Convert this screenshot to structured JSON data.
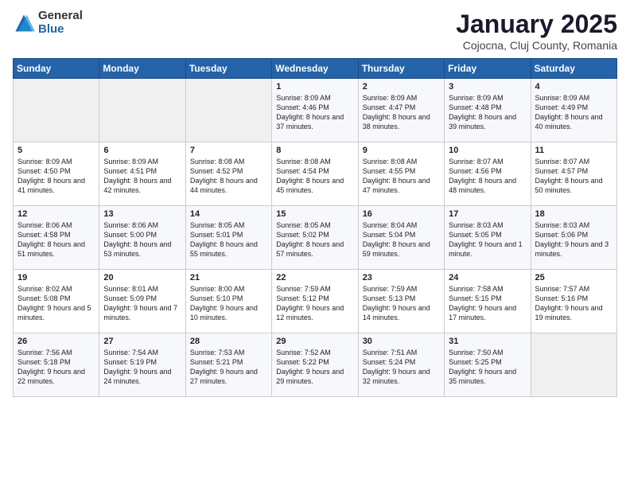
{
  "logo": {
    "general": "General",
    "blue": "Blue"
  },
  "header": {
    "month": "January 2025",
    "location": "Cojocna, Cluj County, Romania"
  },
  "days_of_week": [
    "Sunday",
    "Monday",
    "Tuesday",
    "Wednesday",
    "Thursday",
    "Friday",
    "Saturday"
  ],
  "weeks": [
    [
      {
        "day": "",
        "info": ""
      },
      {
        "day": "",
        "info": ""
      },
      {
        "day": "",
        "info": ""
      },
      {
        "day": "1",
        "info": "Sunrise: 8:09 AM\nSunset: 4:46 PM\nDaylight: 8 hours and 37 minutes."
      },
      {
        "day": "2",
        "info": "Sunrise: 8:09 AM\nSunset: 4:47 PM\nDaylight: 8 hours and 38 minutes."
      },
      {
        "day": "3",
        "info": "Sunrise: 8:09 AM\nSunset: 4:48 PM\nDaylight: 8 hours and 39 minutes."
      },
      {
        "day": "4",
        "info": "Sunrise: 8:09 AM\nSunset: 4:49 PM\nDaylight: 8 hours and 40 minutes."
      }
    ],
    [
      {
        "day": "5",
        "info": "Sunrise: 8:09 AM\nSunset: 4:50 PM\nDaylight: 8 hours and 41 minutes."
      },
      {
        "day": "6",
        "info": "Sunrise: 8:09 AM\nSunset: 4:51 PM\nDaylight: 8 hours and 42 minutes."
      },
      {
        "day": "7",
        "info": "Sunrise: 8:08 AM\nSunset: 4:52 PM\nDaylight: 8 hours and 44 minutes."
      },
      {
        "day": "8",
        "info": "Sunrise: 8:08 AM\nSunset: 4:54 PM\nDaylight: 8 hours and 45 minutes."
      },
      {
        "day": "9",
        "info": "Sunrise: 8:08 AM\nSunset: 4:55 PM\nDaylight: 8 hours and 47 minutes."
      },
      {
        "day": "10",
        "info": "Sunrise: 8:07 AM\nSunset: 4:56 PM\nDaylight: 8 hours and 48 minutes."
      },
      {
        "day": "11",
        "info": "Sunrise: 8:07 AM\nSunset: 4:57 PM\nDaylight: 8 hours and 50 minutes."
      }
    ],
    [
      {
        "day": "12",
        "info": "Sunrise: 8:06 AM\nSunset: 4:58 PM\nDaylight: 8 hours and 51 minutes."
      },
      {
        "day": "13",
        "info": "Sunrise: 8:06 AM\nSunset: 5:00 PM\nDaylight: 8 hours and 53 minutes."
      },
      {
        "day": "14",
        "info": "Sunrise: 8:05 AM\nSunset: 5:01 PM\nDaylight: 8 hours and 55 minutes."
      },
      {
        "day": "15",
        "info": "Sunrise: 8:05 AM\nSunset: 5:02 PM\nDaylight: 8 hours and 57 minutes."
      },
      {
        "day": "16",
        "info": "Sunrise: 8:04 AM\nSunset: 5:04 PM\nDaylight: 8 hours and 59 minutes."
      },
      {
        "day": "17",
        "info": "Sunrise: 8:03 AM\nSunset: 5:05 PM\nDaylight: 9 hours and 1 minute."
      },
      {
        "day": "18",
        "info": "Sunrise: 8:03 AM\nSunset: 5:06 PM\nDaylight: 9 hours and 3 minutes."
      }
    ],
    [
      {
        "day": "19",
        "info": "Sunrise: 8:02 AM\nSunset: 5:08 PM\nDaylight: 9 hours and 5 minutes."
      },
      {
        "day": "20",
        "info": "Sunrise: 8:01 AM\nSunset: 5:09 PM\nDaylight: 9 hours and 7 minutes."
      },
      {
        "day": "21",
        "info": "Sunrise: 8:00 AM\nSunset: 5:10 PM\nDaylight: 9 hours and 10 minutes."
      },
      {
        "day": "22",
        "info": "Sunrise: 7:59 AM\nSunset: 5:12 PM\nDaylight: 9 hours and 12 minutes."
      },
      {
        "day": "23",
        "info": "Sunrise: 7:59 AM\nSunset: 5:13 PM\nDaylight: 9 hours and 14 minutes."
      },
      {
        "day": "24",
        "info": "Sunrise: 7:58 AM\nSunset: 5:15 PM\nDaylight: 9 hours and 17 minutes."
      },
      {
        "day": "25",
        "info": "Sunrise: 7:57 AM\nSunset: 5:16 PM\nDaylight: 9 hours and 19 minutes."
      }
    ],
    [
      {
        "day": "26",
        "info": "Sunrise: 7:56 AM\nSunset: 5:18 PM\nDaylight: 9 hours and 22 minutes."
      },
      {
        "day": "27",
        "info": "Sunrise: 7:54 AM\nSunset: 5:19 PM\nDaylight: 9 hours and 24 minutes."
      },
      {
        "day": "28",
        "info": "Sunrise: 7:53 AM\nSunset: 5:21 PM\nDaylight: 9 hours and 27 minutes."
      },
      {
        "day": "29",
        "info": "Sunrise: 7:52 AM\nSunset: 5:22 PM\nDaylight: 9 hours and 29 minutes."
      },
      {
        "day": "30",
        "info": "Sunrise: 7:51 AM\nSunset: 5:24 PM\nDaylight: 9 hours and 32 minutes."
      },
      {
        "day": "31",
        "info": "Sunrise: 7:50 AM\nSunset: 5:25 PM\nDaylight: 9 hours and 35 minutes."
      },
      {
        "day": "",
        "info": ""
      }
    ]
  ]
}
